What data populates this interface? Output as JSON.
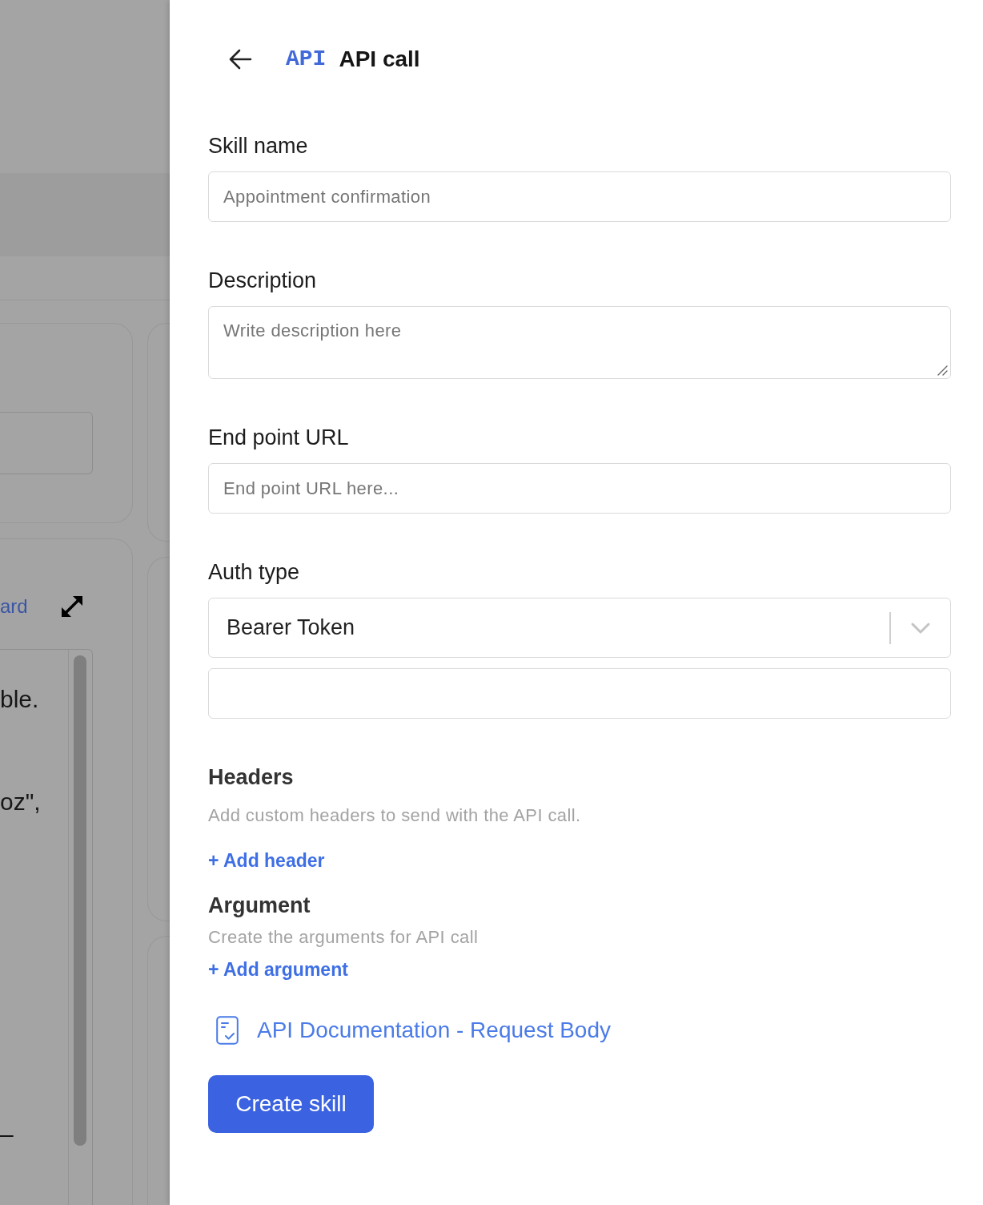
{
  "background_page": {
    "link": "ard",
    "code_lines": [
      "ble.",
      "oz\",",
      "–"
    ]
  },
  "panel": {
    "logo": "API",
    "title": "API call"
  },
  "fields": [
    {
      "kind": "input",
      "label": "Skill name",
      "placeholder": "Appointment confirmation"
    },
    {
      "kind": "textarea",
      "label": "Description",
      "placeholder": "Write description here"
    },
    {
      "kind": "input",
      "label": "End point URL",
      "placeholder": "End point URL here..."
    },
    {
      "kind": "select",
      "label": "Auth type",
      "value": "Bearer Token"
    },
    {
      "kind": "input"
    }
  ],
  "sections": [
    {
      "title": "Headers",
      "description": "Add custom headers to send with the API call.",
      "action": "+ Add header"
    },
    {
      "title": "Argument",
      "description": "Create the arguments for API call",
      "action": "+ Add argument"
    }
  ],
  "doc_link": "API Documentation - Request Body",
  "submit_button": "Create skill"
}
